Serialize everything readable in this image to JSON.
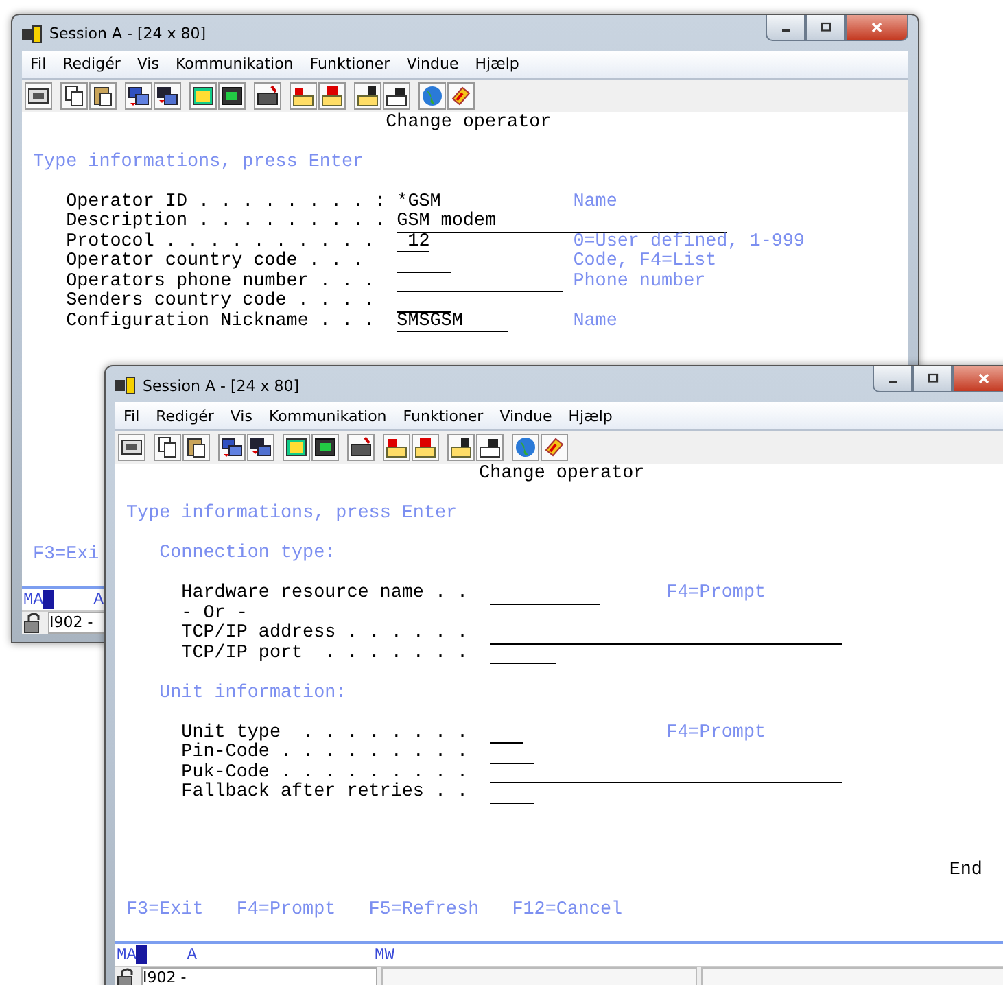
{
  "windows": [
    {
      "title": "Session A - [24 x 80]",
      "menu": [
        "Fil",
        "Redigér",
        "Vis",
        "Kommunikation",
        "Funktioner",
        "Vindue",
        "Hjælp"
      ],
      "screen_title": "Change operator",
      "instruction": "Type informations, press Enter",
      "sections": [
        {
          "fields": [
            {
              "kind": "field",
              "label": "Operator ID . . . . . . . . :",
              "value": "*GSM",
              "input": false,
              "hint": "Name"
            },
            {
              "kind": "field",
              "label": "Description . . . . . . . . .",
              "value": "GSM modem",
              "input": true
            },
            {
              "kind": "field",
              "label": "Protocol . . . . . . . . . .",
              "value": "12",
              "input": true,
              "hint": "0=User defined, 1-999"
            },
            {
              "kind": "field",
              "label": "Operator country code . . .",
              "input": true,
              "hint": "Code, F4=List"
            },
            {
              "kind": "field",
              "label": "Operators phone number . . .",
              "input": true,
              "hint": "Phone number"
            },
            {
              "kind": "field",
              "label": "Senders country code . . . .",
              "input": true
            },
            {
              "kind": "field",
              "label": "Configuration Nickname . . .",
              "value": "SMSGSM",
              "input": true,
              "hint": "Name"
            }
          ]
        }
      ],
      "function_keys": [
        "F3=Exi"
      ],
      "status": [
        "MA",
        "A"
      ],
      "session_info": "I902 -"
    },
    {
      "title": "Session A - [24 x 80]",
      "menu": [
        "Fil",
        "Redigér",
        "Vis",
        "Kommunikation",
        "Funktioner",
        "Vindue",
        "Hjælp"
      ],
      "screen_title": "Change operator",
      "instruction": "Type informations, press Enter",
      "sections": [
        {
          "heading": "Connection type:",
          "fields": [
            {
              "kind": "field",
              "label": "Hardware resource name . .",
              "input": true,
              "hint": "F4=Prompt"
            },
            {
              "kind": "note",
              "label": "- Or -"
            },
            {
              "kind": "field",
              "label": "TCP/IP address . . . . . .",
              "input": true
            },
            {
              "kind": "field",
              "label": "TCP/IP port  . . . . . . .",
              "input": true
            }
          ]
        },
        {
          "heading": "Unit information:",
          "fields": [
            {
              "kind": "field",
              "label": "Unit type  . . . . . . . .",
              "input": true,
              "hint": "F4=Prompt"
            },
            {
              "kind": "field",
              "label": "Pin-Code . . . . . . . . .",
              "input": true
            },
            {
              "kind": "field",
              "label": "Puk-Code . . . . . . . . .",
              "input": true
            },
            {
              "kind": "field",
              "label": "Fallback after retries . .",
              "input": true
            }
          ]
        }
      ],
      "end_text": "End",
      "function_keys": [
        "F3=Exit",
        "F4=Prompt",
        "F5=Refresh",
        "F12=Cancel"
      ],
      "status": [
        "MA",
        "A",
        "MW"
      ],
      "session_info": "I902 -"
    }
  ]
}
